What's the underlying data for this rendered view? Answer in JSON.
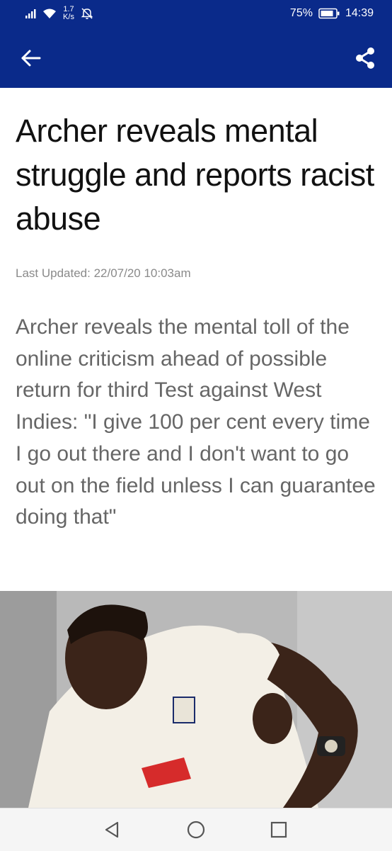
{
  "status_bar": {
    "net_speed_value": "1.7",
    "net_speed_unit": "K/s",
    "battery": "75%",
    "time": "14:39"
  },
  "app_bar": {
    "back_icon": "arrow-left-icon",
    "share_icon": "share-icon"
  },
  "article": {
    "title": "Archer reveals mental struggle and reports racist abuse",
    "last_updated": "Last Updated: 22/07/20 10:03am",
    "standfirst": "Archer reveals the mental toll of the online criticism ahead of possible return for third Test against West Indies: \"I give 100 per cent every time I go out there and I don't want to go out on the field unless I can guarantee doing that\""
  },
  "nav_bar": {
    "back_icon": "triangle-back-icon",
    "home_icon": "circle-home-icon",
    "recents_icon": "square-recents-icon"
  },
  "colors": {
    "brand_blue": "#0a2a8a",
    "title_text": "#111111",
    "meta_text": "#8a8a8a",
    "standfirst_text": "#666666"
  }
}
